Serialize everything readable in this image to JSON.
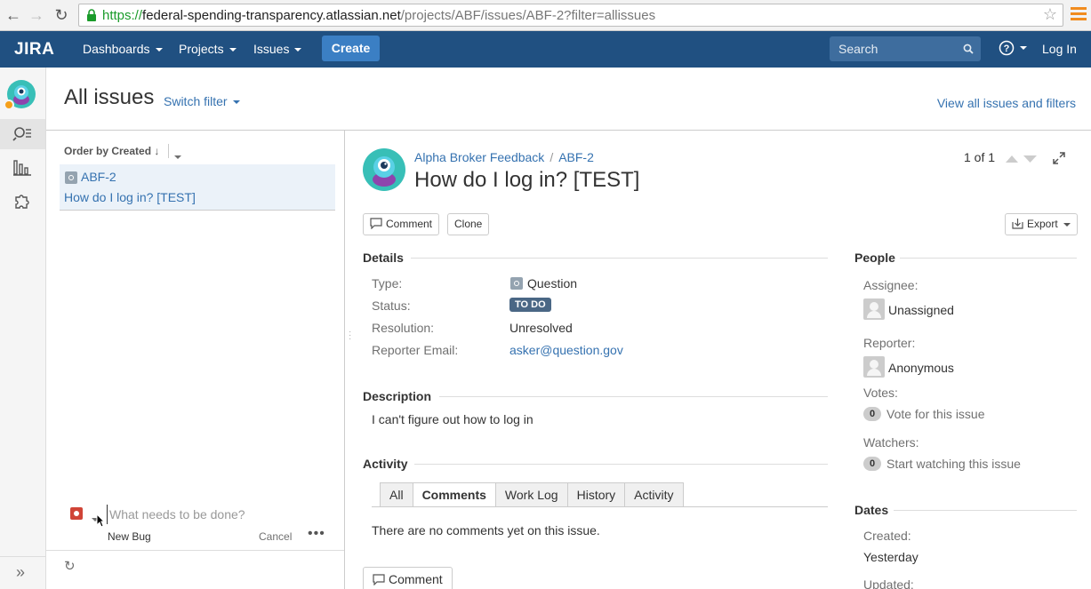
{
  "browser": {
    "url_scheme": "https://",
    "url_host": "federal-spending-transparency.atlassian.net",
    "url_path": "/projects/ABF/issues/ABF-2?filter=allissues"
  },
  "header": {
    "logo": "JIRA",
    "nav": [
      "Dashboards",
      "Projects",
      "Issues"
    ],
    "create_label": "Create",
    "search_placeholder": "Search",
    "login_label": "Log In"
  },
  "page": {
    "title": "All issues",
    "switch_filter": "Switch filter",
    "view_all": "View all issues and filters"
  },
  "issue_list": {
    "order_by": "Order by Created",
    "items": [
      {
        "key": "ABF-2",
        "summary": "How do I log in? [TEST]"
      }
    ],
    "inline_create": {
      "placeholder": "What needs to be done?",
      "issue_type": "New Bug",
      "cancel": "Cancel",
      "more": "•••"
    }
  },
  "issue": {
    "project": "Alpha Broker Feedback",
    "key": "ABF-2",
    "title": "How do I log in? [TEST]",
    "pager": "1 of 1",
    "buttons": {
      "comment": "Comment",
      "clone": "Clone",
      "export": "Export"
    },
    "details": {
      "heading": "Details",
      "type_label": "Type:",
      "type_value": "Question",
      "status_label": "Status:",
      "status_value": "TO DO",
      "resolution_label": "Resolution:",
      "resolution_value": "Unresolved",
      "reporter_email_label": "Reporter Email:",
      "reporter_email_value": "asker@question.gov"
    },
    "description": {
      "heading": "Description",
      "text": "I can't figure out how to log in"
    },
    "activity": {
      "heading": "Activity",
      "tabs": [
        "All",
        "Comments",
        "Work Log",
        "History",
        "Activity"
      ],
      "active_tab": "Comments",
      "empty_text": "There are no comments yet on this issue.",
      "comment_button": "Comment"
    },
    "people": {
      "heading": "People",
      "assignee_label": "Assignee:",
      "assignee_value": "Unassigned",
      "reporter_label": "Reporter:",
      "reporter_value": "Anonymous",
      "votes_label": "Votes:",
      "votes_count": "0",
      "votes_link": "Vote for this issue",
      "watchers_label": "Watchers:",
      "watchers_count": "0",
      "watchers_link": "Start watching this issue"
    },
    "dates": {
      "heading": "Dates",
      "created_label": "Created:",
      "created_value": "Yesterday",
      "updated_label": "Updated:"
    }
  },
  "colors": {
    "header_bg": "#205081",
    "create_btn": "#3b7fc4",
    "link": "#3572b0",
    "status_todo": "#4a6785",
    "project_avatar": "#38bfb7"
  }
}
